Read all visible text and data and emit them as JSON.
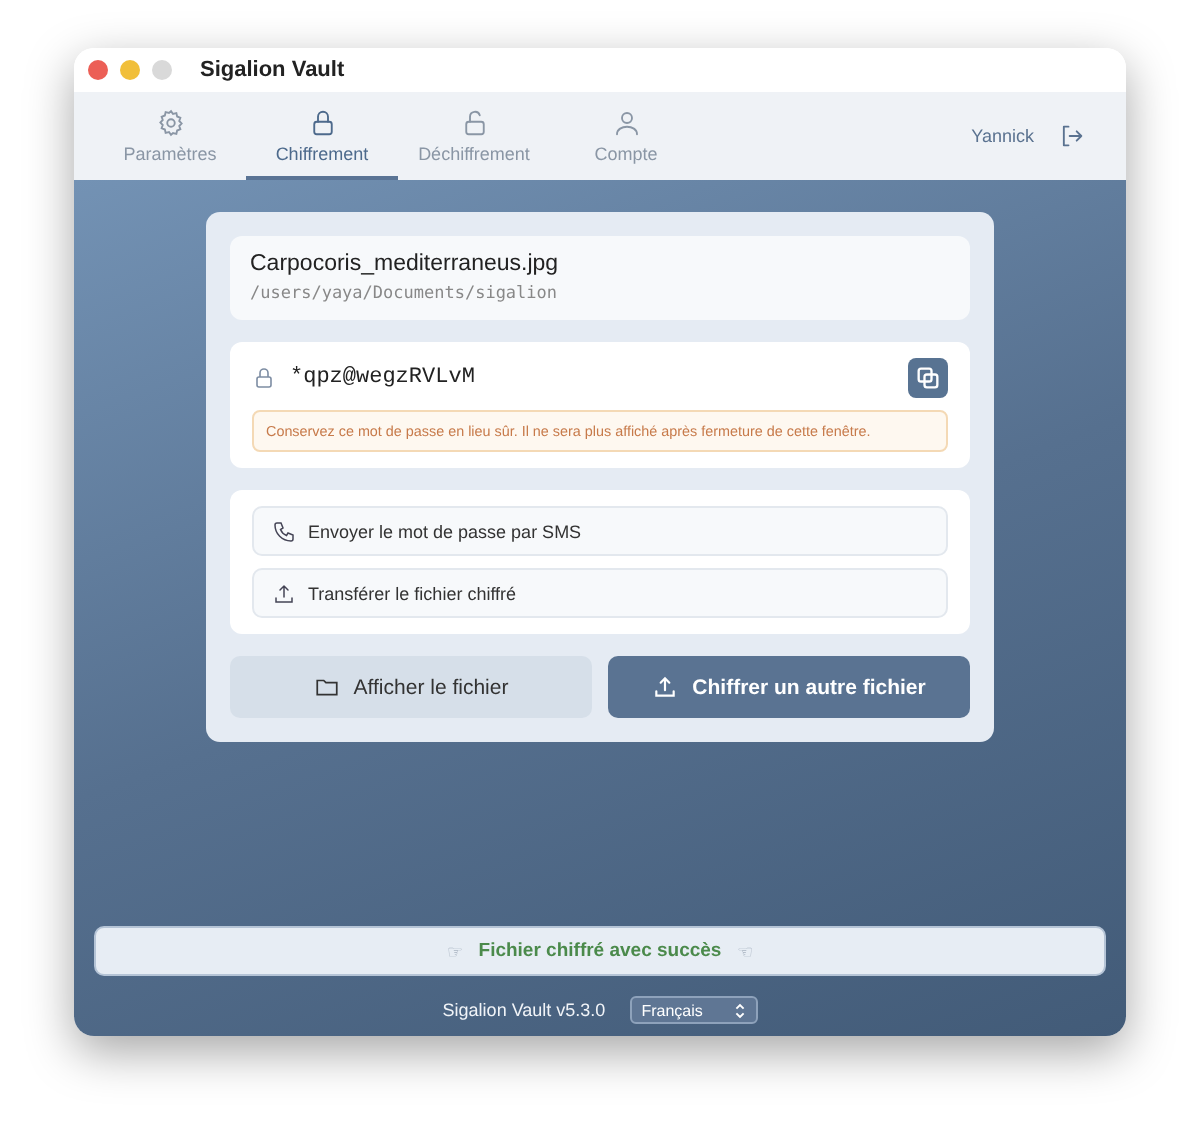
{
  "window": {
    "title": "Sigalion Vault"
  },
  "tabs": [
    {
      "label": "Paramètres",
      "kind": "gear",
      "selected": false
    },
    {
      "label": "Chiffrement",
      "kind": "lock",
      "selected": true
    },
    {
      "label": "Déchiffrement",
      "kind": "unlock",
      "selected": false
    },
    {
      "label": "Compte",
      "kind": "user",
      "selected": false
    }
  ],
  "user": {
    "name": "Yannick"
  },
  "file": {
    "name": "Carpocoris_mediterraneus.jpg",
    "path": "/users/yaya/Documents/sigalion"
  },
  "password": {
    "value": "*qpz@wegzRVLvM",
    "warning": "Conservez ce mot de passe en lieu sûr. Il ne sera plus affiché après fermeture de cette fenêtre."
  },
  "share_actions": [
    {
      "kind": "phone",
      "label": "Envoyer le mot de passe par SMS"
    },
    {
      "kind": "upload",
      "label": "Transférer le fichier chiffré"
    }
  ],
  "buttons": [
    {
      "kind": "folder",
      "label": "Afficher le fichier",
      "primary": false
    },
    {
      "kind": "upload",
      "label": "Chiffrer un autre fichier",
      "primary": true
    }
  ],
  "status": {
    "left_mark": "☞",
    "message": "Fichier chiffré avec succès",
    "right_mark": "☜"
  },
  "footer": {
    "version": "Sigalion Vault v5.3.0",
    "language": "Français"
  }
}
